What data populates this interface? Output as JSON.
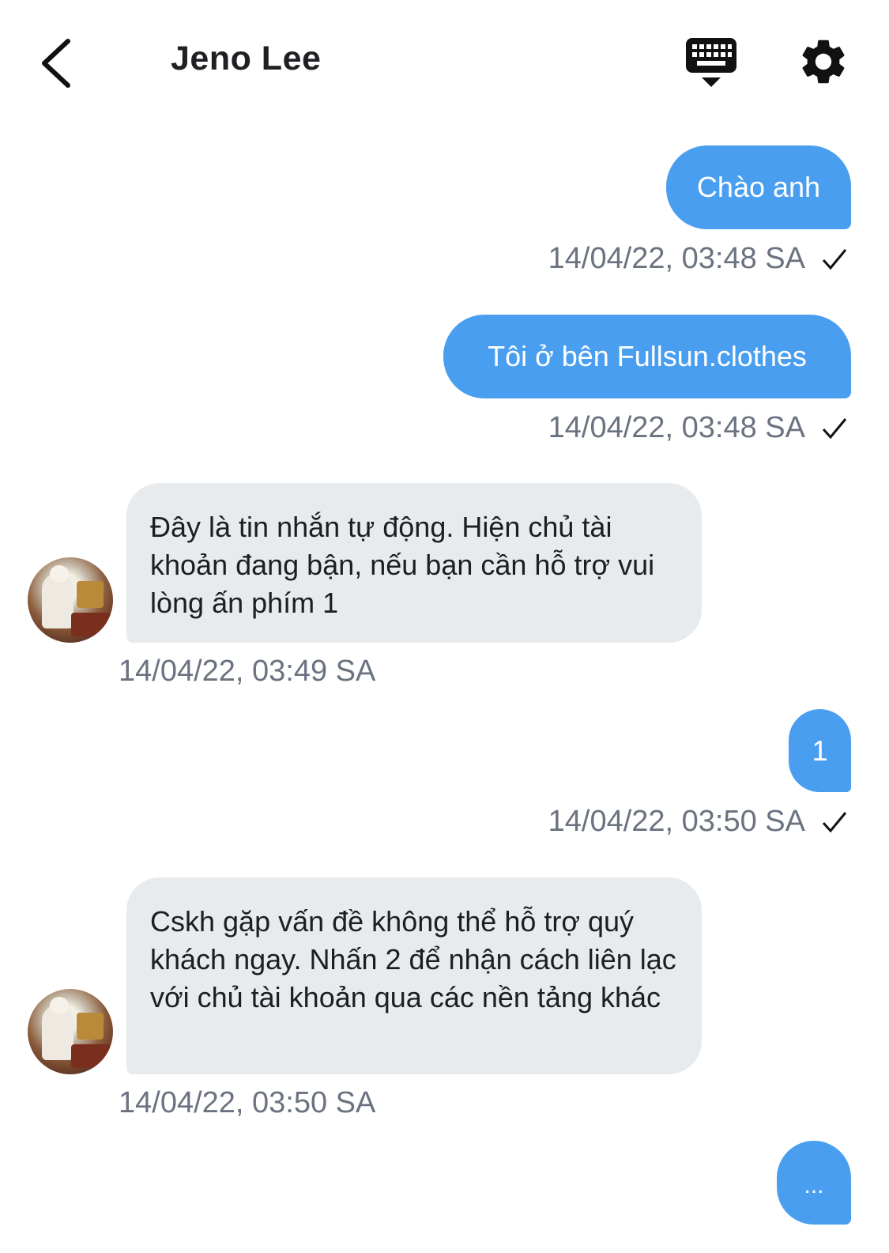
{
  "header": {
    "title": "Jeno Lee",
    "back_icon": "chevron-left-icon",
    "keyboard_icon": "keyboard-icon",
    "settings_icon": "gear-icon"
  },
  "messages": [
    {
      "side": "out",
      "text": "Chào anh",
      "time": "14/04/22, 03:48 SA",
      "status": "sent"
    },
    {
      "side": "out",
      "text": "Tôi ở bên Fullsun.clothes",
      "time": "14/04/22, 03:48 SA",
      "status": "sent"
    },
    {
      "side": "in",
      "text": "Đây là tin nhắn tự động. Hiện chủ tài khoản đang bận, nếu bạn cần hỗ trợ vui lòng ấn phím 1",
      "time": "14/04/22, 03:49 SA"
    },
    {
      "side": "out",
      "text": "1",
      "time": "14/04/22, 03:50 SA",
      "status": "sent"
    },
    {
      "side": "in",
      "text": "Cskh gặp vấn đề không thể hỗ trợ quý khách ngay. Nhấn 2 để nhận cách liên lạc với chủ tài khoản qua các nền tảng khác",
      "time": "14/04/22, 03:50 SA"
    },
    {
      "side": "out",
      "text": "...",
      "status": "typing"
    }
  ],
  "colors": {
    "outgoing_bubble": "#4a9ef0",
    "incoming_bubble": "#e8ebee",
    "timestamp": "#6b7280"
  }
}
